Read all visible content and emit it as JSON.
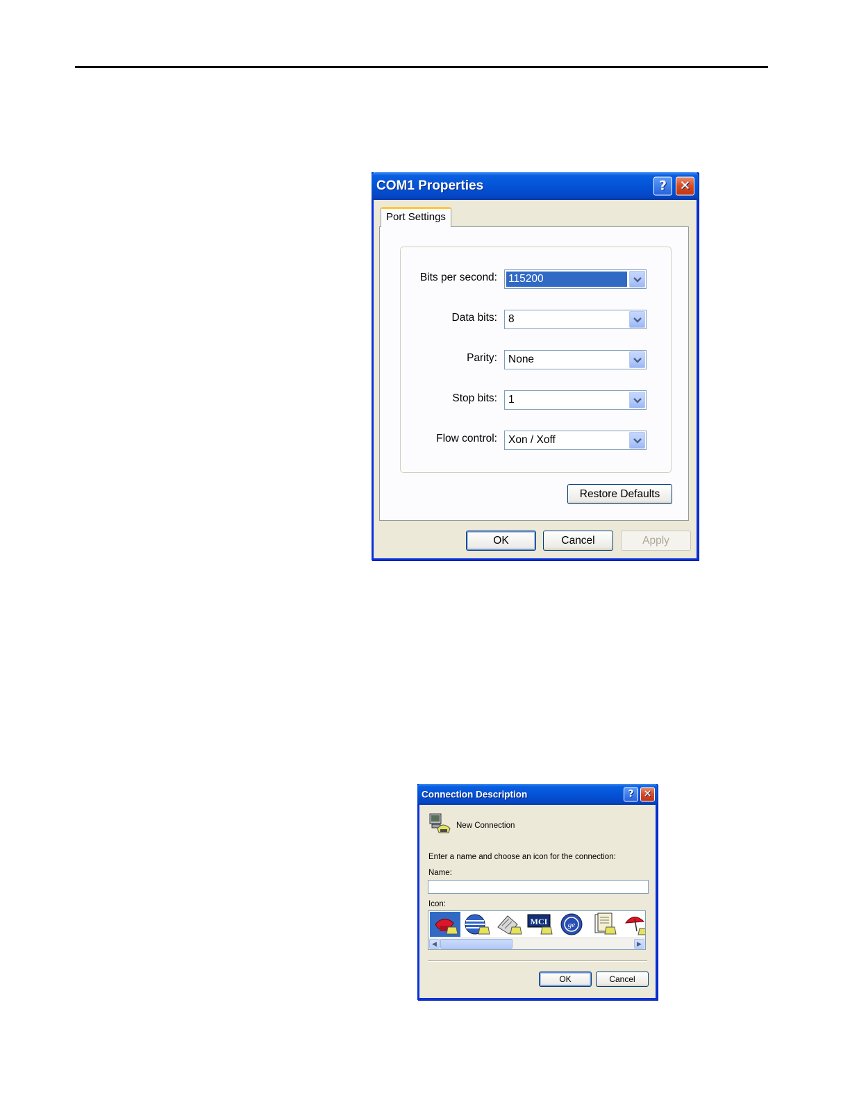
{
  "com1": {
    "title": "COM1 Properties",
    "help_glyph": "?",
    "close_glyph": "✕",
    "tab_label": "Port Settings",
    "fields": [
      {
        "label": "Bits per second:",
        "value": "115200",
        "selected": true
      },
      {
        "label": "Data bits:",
        "value": "8"
      },
      {
        "label": "Parity:",
        "value": "None"
      },
      {
        "label": "Stop bits:",
        "value": "1"
      },
      {
        "label": "Flow control:",
        "value": "Xon / Xoff"
      }
    ],
    "restore_label": "Restore Defaults",
    "ok_label": "OK",
    "cancel_label": "Cancel",
    "apply_label": "Apply"
  },
  "conn": {
    "title": "Connection Description",
    "help_glyph": "?",
    "close_glyph": "✕",
    "new_connection": "New Connection",
    "prompt": "Enter a name and choose an icon for the connection:",
    "name_label": "Name:",
    "name_value": "",
    "icon_label": "Icon:",
    "icons": [
      "red-telephone-icon",
      "globe-icon",
      "fax-icon",
      "mci-icon",
      "ge-globe-icon",
      "document-icon",
      "umbrella-icon"
    ],
    "icon_badge_mci": "MCI",
    "icon_badge_ge": "ge",
    "ok_label": "OK",
    "cancel_label": "Cancel"
  },
  "colors": {
    "title_blue": "#0453d6",
    "dialog_face": "#ece9d8",
    "selection": "#316ac5",
    "tab_accent": "#ffc83c"
  }
}
